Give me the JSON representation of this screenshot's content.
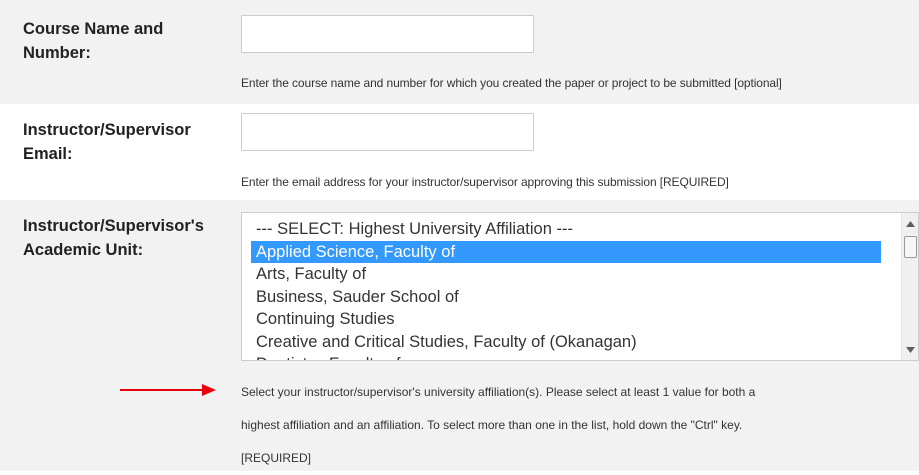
{
  "course": {
    "label_line1": "Course Name and",
    "label_line2": "Number:",
    "value": "",
    "help": "Enter the course name and number for which you created the paper or project to be submitted [optional]"
  },
  "email": {
    "label_line1": "Instructor/Supervisor",
    "label_line2": "Email:",
    "value": "",
    "help": "Enter the email address for your instructor/supervisor approving this submission [REQUIRED]"
  },
  "academic_unit": {
    "label_line1": "Instructor/Supervisor's",
    "label_line2": "Academic Unit:",
    "options": [
      "--- SELECT: Highest University Affiliation ---",
      "Applied Science, Faculty of",
      "Arts, Faculty of",
      "Business, Sauder School of",
      "Continuing Studies",
      "Creative and Critical Studies, Faculty of (Okanagan)",
      "Dentistry, Faculty of"
    ],
    "selected": "Applied Science, Faculty of",
    "help_line1": "Select your instructor/supervisor's university affiliation(s). Please select at least 1 value for both a",
    "help_line2": "highest affiliation and an affiliation. To select more than one in the list, hold down the \"Ctrl\" key.",
    "help_line3": "[REQUIRED]"
  },
  "colors": {
    "row_shade": "#f2f2f2",
    "selection": "#3399ff",
    "arrow": "#e8000b"
  },
  "icons": {
    "scroll_up": "triangle-up",
    "scroll_down": "triangle-down",
    "annotation": "red-arrow-right"
  }
}
